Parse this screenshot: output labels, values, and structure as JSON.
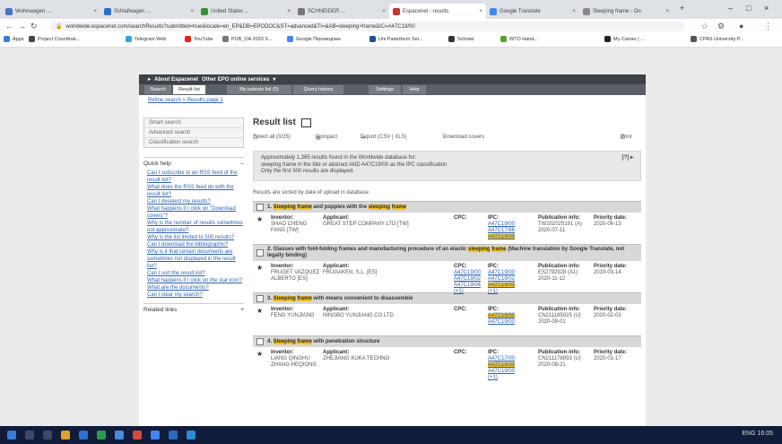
{
  "browser": {
    "tabs": [
      {
        "label": "Wohnwagen ..."
      },
      {
        "label": "Schlafwagen ..."
      },
      {
        "label": "United States ..."
      },
      {
        "label": "SCHNEIDER ..."
      },
      {
        "label": "Espacenet - results"
      },
      {
        "label": "Google Translate"
      },
      {
        "label": "Sleeping frame - On"
      }
    ],
    "url": "worldwide.espacenet.com/searchResults?submitted=true&locale=en_EP&DB=EPODOC&ST=advanced&TI=&AB=sleeping+frame&IC=A47C19/00",
    "bookmarks": [
      "Apps",
      "Project Coordinat...",
      "Telegram Web",
      "YouTube",
      "PUB_OA 2020 S...",
      "Google Переводчик",
      "Uni Paderborn Sei...",
      "Scholar",
      "WTO Hand...",
      "My Career | ...",
      "CPAS University P..."
    ]
  },
  "espacenet": {
    "topbar": {
      "about": "About Espacenet",
      "other": "Other EPO online services"
    },
    "menu": [
      "Search",
      "Result list",
      "My patents list (0)",
      "Query history",
      "Settings",
      "Help"
    ],
    "breadcrumb": "Refine search » Results page 1",
    "sidebar": {
      "search_links": [
        "Smart search",
        "Advanced search",
        "Classification search"
      ],
      "quick_help_title": "Quick help",
      "quick_help_links": [
        "Can I subscribe to an RSS feed of the result list?",
        "What does the RSS feed do with the result list?",
        "Can I deselect my results?",
        "What happens if I click on \"Download covers\"?",
        "Why is the number of results sometimes not approximate?",
        "Why is the list limited to 500 results?",
        "Can I download the bibliographic?",
        "Why is it that certain documents are sometimes not displayed in the result list?",
        "Can I sort the result list?",
        "What happens if I click on the star icon?",
        "What are the documents?",
        "Can I clear my search?"
      ],
      "related_links_title": "Related links"
    },
    "results": {
      "title": "Result list",
      "toolbar": {
        "select_all": "Select all (0/25)",
        "compact": "Compact",
        "export": "Export (CSV | XLS)",
        "download_covers": "Download covers",
        "print": "Print"
      },
      "info": [
        "Approximately 1,365 results found in the Worldwide database for:",
        "sleeping frame in the title or abstract AND A47C19/00 as the IPC classification",
        "Only the first 500 results are displayed."
      ],
      "info_toggle": "[?] ▸",
      "sorted_note": "Results are sorted by date of upload in database",
      "labels": {
        "inventor": "Inventor:",
        "applicant": "Applicant:",
        "cpc": "CPC:",
        "ipc": "IPC:",
        "publication": "Publication info:",
        "priority": "Priority date:"
      },
      "records": [
        {
          "num": "1.",
          "title_parts": [
            {
              "t": "Sleeping",
              "hl": true
            },
            {
              "t": " ",
              "hl": false
            },
            {
              "t": "frame",
              "hl": true
            },
            {
              "t": " and poppies with the ",
              "hl": false
            },
            {
              "t": "sleeping",
              "hl": true
            },
            {
              "t": " ",
              "hl": false
            },
            {
              "t": "frame",
              "hl": true
            }
          ],
          "inventor": "SHAO CHENG\nFANG [TW]",
          "applicant": "GREAT STEP COMPANY LTD [TW]",
          "cpc": "",
          "ipc": [
            "A47C19/00",
            "A47C17/86",
            "A47C19/00"
          ],
          "ipc_hl": [
            false,
            false,
            true
          ],
          "publication": "TW202025191 (A)\n2020-07-11",
          "priority": "2020-06-13"
        },
        {
          "num": "2.",
          "title_parts": [
            {
              "t": "Glasses with fold-folding frames and manufacturing procedure of an elastic ",
              "hl": false
            },
            {
              "t": "sleeping",
              "hl": true
            },
            {
              "t": " ",
              "hl": false
            },
            {
              "t": "frame",
              "hl": true
            },
            {
              "t": " (Machine translation by Google Translate, not legally binding)",
              "hl": false
            }
          ],
          "inventor": "FRUGET VAZQUEZ\nALBERTO [ES]",
          "applicant": "FRUGAKEN, S.L. [ES]",
          "cpc": "A47C19/00\nA47C19/02\nA47C19/04\n(+1)",
          "ipc": [
            "A47C19/00",
            "A47C19/02",
            "A47C19/00",
            "(+1)"
          ],
          "ipc_hl": [
            false,
            false,
            true,
            false
          ],
          "publication": "ES2792928 (A1)\n2020-11-12",
          "priority": "2019-03-14"
        },
        {
          "num": "3.",
          "title_parts": [
            {
              "t": "Sleeping",
              "hl": true
            },
            {
              "t": " ",
              "hl": false
            },
            {
              "t": "frame",
              "hl": true
            },
            {
              "t": " with means convenient to disassemble",
              "hl": false
            }
          ],
          "inventor": "FENG YUNJIANG",
          "applicant": "NINGBO YUNJIANG CO LTD",
          "cpc": "",
          "ipc": [
            "A47C19/00",
            "A47C19/00"
          ],
          "ipc_hl": [
            true,
            false
          ],
          "publication": "CN211185025 (U)\n2020-09-01",
          "priority": "2020-02-03"
        },
        {
          "num": "4.",
          "title_parts": [
            {
              "t": "Sleeping",
              "hl": true
            },
            {
              "t": " ",
              "hl": false
            },
            {
              "t": "frame",
              "hl": true
            },
            {
              "t": " with penetration structure",
              "hl": false
            }
          ],
          "inventor": "LIANG QINGHU\nZHANG HEQIONG",
          "applicant": "ZHEJIANG KUKA TECHNO",
          "cpc": "",
          "ipc": [
            "A47C17/00",
            "A47C19/00",
            "A47C19/00",
            "(+1)"
          ],
          "ipc_hl": [
            false,
            true,
            false,
            false
          ],
          "publication": "CN211178993 (U)\n2020-08-21",
          "priority": "2020-01-17"
        }
      ]
    }
  },
  "taskbar": {
    "tray_text": "ENG 16:05"
  }
}
